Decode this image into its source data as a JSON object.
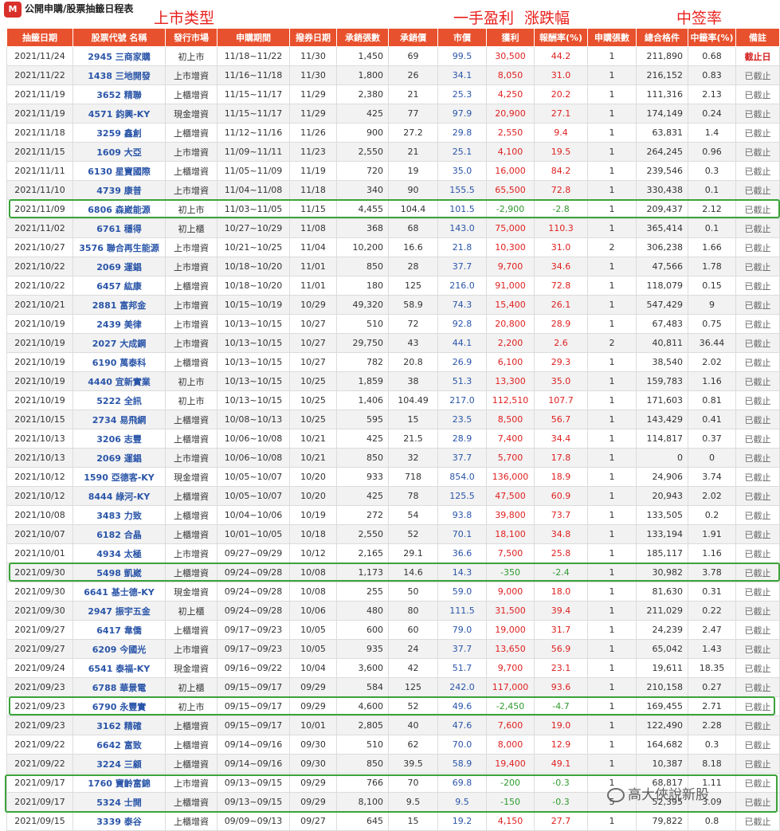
{
  "header": {
    "logo_text": "M",
    "title": "公開申購/股票抽籤日程表"
  },
  "annotations": {
    "market_type": "上市类型",
    "profit": "一手盈利",
    "change": "涨跌幅",
    "win_rate": "中签率"
  },
  "columns": [
    "抽籤日期",
    "股票代號 名稱",
    "發行市場",
    "申購期間",
    "撥券日期",
    "承銷張數",
    "承銷價",
    "市價",
    "獲利",
    "報酬率(%)",
    "申購張數",
    "總合格件",
    "中籤率(%)",
    "備註"
  ],
  "rows": [
    [
      "2021/11/24",
      "2945 三商家購",
      "初上市",
      "11/18~11/22",
      "11/30",
      "1,450",
      "69",
      "99.5",
      "30,500",
      "44.2",
      "1",
      "211,890",
      "0.68",
      "截止日"
    ],
    [
      "2021/11/22",
      "1438 三地開發",
      "上市增資",
      "11/16~11/18",
      "11/30",
      "1,800",
      "26",
      "34.1",
      "8,050",
      "31.0",
      "1",
      "216,152",
      "0.83",
      "已截止"
    ],
    [
      "2021/11/19",
      "3652 精聯",
      "上櫃增資",
      "11/15~11/17",
      "11/29",
      "2,380",
      "21",
      "25.3",
      "4,250",
      "20.2",
      "1",
      "111,316",
      "2.13",
      "已截止"
    ],
    [
      "2021/11/19",
      "4571 鈞興-KY",
      "現金增資",
      "11/15~11/17",
      "11/29",
      "425",
      "77",
      "97.9",
      "20,900",
      "27.1",
      "1",
      "174,149",
      "0.24",
      "已截止"
    ],
    [
      "2021/11/18",
      "3259 鑫創",
      "上櫃增資",
      "11/12~11/16",
      "11/26",
      "900",
      "27.2",
      "29.8",
      "2,550",
      "9.4",
      "1",
      "63,831",
      "1.4",
      "已截止"
    ],
    [
      "2021/11/15",
      "1609 大亞",
      "上市增資",
      "11/09~11/11",
      "11/23",
      "2,550",
      "21",
      "25.1",
      "4,100",
      "19.5",
      "1",
      "264,245",
      "0.96",
      "已截止"
    ],
    [
      "2021/11/11",
      "6130 星寶國際",
      "上櫃增資",
      "11/05~11/09",
      "11/19",
      "720",
      "19",
      "35.0",
      "16,000",
      "84.2",
      "1",
      "239,546",
      "0.3",
      "已截止"
    ],
    [
      "2021/11/10",
      "4739 康普",
      "上市增資",
      "11/04~11/08",
      "11/18",
      "340",
      "90",
      "155.5",
      "65,500",
      "72.8",
      "1",
      "330,438",
      "0.1",
      "已截止"
    ],
    [
      "2021/11/09",
      "6806 森崴能源",
      "初上市",
      "11/03~11/05",
      "11/15",
      "4,455",
      "104.4",
      "101.5",
      "-2,900",
      "-2.8",
      "1",
      "209,437",
      "2.12",
      "已截止"
    ],
    [
      "2021/11/02",
      "6761 穩得",
      "初上櫃",
      "10/27~10/29",
      "11/08",
      "368",
      "68",
      "143.0",
      "75,000",
      "110.3",
      "1",
      "365,414",
      "0.1",
      "已截止"
    ],
    [
      "2021/10/27",
      "3576 聯合再生能源",
      "上市增資",
      "10/21~10/25",
      "11/04",
      "10,200",
      "16.6",
      "21.8",
      "10,300",
      "31.0",
      "2",
      "306,238",
      "1.66",
      "已截止"
    ],
    [
      "2021/10/22",
      "2069 運錩",
      "上市增資",
      "10/18~10/20",
      "11/01",
      "850",
      "28",
      "37.7",
      "9,700",
      "34.6",
      "1",
      "47,566",
      "1.78",
      "已截止"
    ],
    [
      "2021/10/22",
      "6457 紘康",
      "上櫃增資",
      "10/18~10/20",
      "11/01",
      "180",
      "125",
      "216.0",
      "91,000",
      "72.8",
      "1",
      "118,079",
      "0.15",
      "已截止"
    ],
    [
      "2021/10/21",
      "2881 富邦金",
      "上市增資",
      "10/15~10/19",
      "10/29",
      "49,320",
      "58.9",
      "74.3",
      "15,400",
      "26.1",
      "1",
      "547,429",
      "9",
      "已截止"
    ],
    [
      "2021/10/19",
      "2439 美律",
      "上市增資",
      "10/13~10/15",
      "10/27",
      "510",
      "72",
      "92.8",
      "20,800",
      "28.9",
      "1",
      "67,483",
      "0.75",
      "已截止"
    ],
    [
      "2021/10/19",
      "2027 大成鋼",
      "上市增資",
      "10/13~10/15",
      "10/27",
      "29,750",
      "43",
      "44.1",
      "2,200",
      "2.6",
      "2",
      "40,811",
      "36.44",
      "已截止"
    ],
    [
      "2021/10/19",
      "6190 萬泰科",
      "上櫃增資",
      "10/13~10/15",
      "10/27",
      "782",
      "20.8",
      "26.9",
      "6,100",
      "29.3",
      "1",
      "38,540",
      "2.02",
      "已截止"
    ],
    [
      "2021/10/19",
      "4440 宜新實業",
      "初上市",
      "10/13~10/15",
      "10/25",
      "1,859",
      "38",
      "51.3",
      "13,300",
      "35.0",
      "1",
      "159,783",
      "1.16",
      "已截止"
    ],
    [
      "2021/10/19",
      "5222 全訊",
      "初上市",
      "10/13~10/15",
      "10/25",
      "1,406",
      "104.49",
      "217.0",
      "112,510",
      "107.7",
      "1",
      "171,603",
      "0.81",
      "已截止"
    ],
    [
      "2021/10/15",
      "2734 易飛網",
      "上櫃增資",
      "10/08~10/13",
      "10/25",
      "595",
      "15",
      "23.5",
      "8,500",
      "56.7",
      "1",
      "143,429",
      "0.41",
      "已截止"
    ],
    [
      "2021/10/13",
      "3206 志豐",
      "上櫃增資",
      "10/06~10/08",
      "10/21",
      "425",
      "21.5",
      "28.9",
      "7,400",
      "34.4",
      "1",
      "114,817",
      "0.37",
      "已截止"
    ],
    [
      "2021/10/13",
      "2069 運錩",
      "上市增資",
      "10/06~10/08",
      "10/21",
      "850",
      "32",
      "37.7",
      "5,700",
      "17.8",
      "1",
      "0",
      "0",
      "已截止"
    ],
    [
      "2021/10/12",
      "1590 亞德客-KY",
      "現金增資",
      "10/05~10/07",
      "10/20",
      "933",
      "718",
      "854.0",
      "136,000",
      "18.9",
      "1",
      "24,906",
      "3.74",
      "已截止"
    ],
    [
      "2021/10/12",
      "8444 綠河-KY",
      "上櫃增資",
      "10/05~10/07",
      "10/20",
      "425",
      "78",
      "125.5",
      "47,500",
      "60.9",
      "1",
      "20,943",
      "2.02",
      "已截止"
    ],
    [
      "2021/10/08",
      "3483 力致",
      "上櫃增資",
      "10/04~10/06",
      "10/19",
      "272",
      "54",
      "93.8",
      "39,800",
      "73.7",
      "1",
      "133,505",
      "0.2",
      "已截止"
    ],
    [
      "2021/10/07",
      "6182 合晶",
      "上櫃增資",
      "10/01~10/05",
      "10/18",
      "2,550",
      "52",
      "70.1",
      "18,100",
      "34.8",
      "1",
      "133,194",
      "1.91",
      "已截止"
    ],
    [
      "2021/10/01",
      "4934 太極",
      "上市增資",
      "09/27~09/29",
      "10/12",
      "2,165",
      "29.1",
      "36.6",
      "7,500",
      "25.8",
      "1",
      "185,117",
      "1.16",
      "已截止"
    ],
    [
      "2021/09/30",
      "5498 凱崴",
      "上櫃增資",
      "09/24~09/28",
      "10/08",
      "1,173",
      "14.6",
      "14.3",
      "-350",
      "-2.4",
      "1",
      "30,982",
      "3.78",
      "已截止"
    ],
    [
      "2021/09/30",
      "6641 基士德-KY",
      "現金增資",
      "09/24~09/28",
      "10/08",
      "255",
      "50",
      "59.0",
      "9,000",
      "18.0",
      "1",
      "81,630",
      "0.31",
      "已截止"
    ],
    [
      "2021/09/30",
      "2947 振宇五金",
      "初上櫃",
      "09/24~09/28",
      "10/06",
      "480",
      "80",
      "111.5",
      "31,500",
      "39.4",
      "1",
      "211,029",
      "0.22",
      "已截止"
    ],
    [
      "2021/09/27",
      "6417 韋僑",
      "上櫃增資",
      "09/17~09/23",
      "10/05",
      "600",
      "60",
      "79.0",
      "19,000",
      "31.7",
      "1",
      "24,239",
      "2.47",
      "已截止"
    ],
    [
      "2021/09/27",
      "6209 今國光",
      "上市增資",
      "09/17~09/23",
      "10/05",
      "935",
      "24",
      "37.7",
      "13,650",
      "56.9",
      "1",
      "65,042",
      "1.43",
      "已截止"
    ],
    [
      "2021/09/24",
      "6541 泰福-KY",
      "現金增資",
      "09/16~09/22",
      "10/04",
      "3,600",
      "42",
      "51.7",
      "9,700",
      "23.1",
      "1",
      "19,611",
      "18.35",
      "已截止"
    ],
    [
      "2021/09/23",
      "6788 華景電",
      "初上櫃",
      "09/15~09/17",
      "09/29",
      "584",
      "125",
      "242.0",
      "117,000",
      "93.6",
      "1",
      "210,158",
      "0.27",
      "已截止"
    ],
    [
      "2021/09/23",
      "6790 永豐實",
      "初上市",
      "09/15~09/17",
      "09/29",
      "4,600",
      "52",
      "49.6",
      "-2,450",
      "-4.7",
      "1",
      "169,455",
      "2.71",
      "已截止"
    ],
    [
      "2021/09/23",
      "3162 精確",
      "上櫃增資",
      "09/15~09/17",
      "10/01",
      "2,805",
      "40",
      "47.6",
      "7,600",
      "19.0",
      "1",
      "122,490",
      "2.28",
      "已截止"
    ],
    [
      "2021/09/22",
      "6642 富致",
      "上櫃增資",
      "09/14~09/16",
      "09/30",
      "510",
      "62",
      "70.0",
      "8,000",
      "12.9",
      "1",
      "164,682",
      "0.3",
      "已截止"
    ],
    [
      "2021/09/22",
      "3224 三顧",
      "上櫃增資",
      "09/14~09/16",
      "09/30",
      "850",
      "39.5",
      "58.9",
      "19,400",
      "49.1",
      "1",
      "10,387",
      "8.18",
      "已截止"
    ],
    [
      "2021/09/17",
      "1760 寶齡富錦",
      "上市增資",
      "09/13~09/15",
      "09/29",
      "766",
      "70",
      "69.8",
      "-200",
      "-0.3",
      "1",
      "68,817",
      "1.11",
      "已截止"
    ],
    [
      "2021/09/17",
      "5324 士開",
      "上櫃增資",
      "09/13~09/15",
      "09/29",
      "8,100",
      "9.5",
      "9.5",
      "-150",
      "-0.3",
      "5",
      "52,395",
      "3.09",
      "已截止"
    ],
    [
      "2021/09/15",
      "3339 泰谷",
      "上櫃增資",
      "09/09~09/13",
      "09/27",
      "645",
      "15",
      "19.2",
      "4,150",
      "27.7",
      "1",
      "79,822",
      "0.8",
      "已截止"
    ]
  ],
  "negative_rows": [
    8,
    27,
    34,
    38,
    39
  ],
  "colors": {
    "header_bg": "#e8512d",
    "negative": "#2e9a2e",
    "positive": "#e02020",
    "link": "#2a55a8",
    "highlight_box": "#3ba33b"
  },
  "watermark": "高大俠說新股"
}
